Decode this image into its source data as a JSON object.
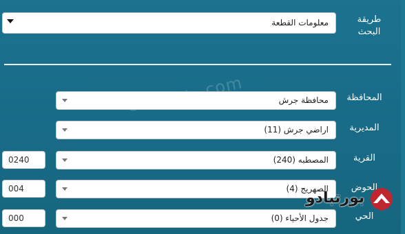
{
  "search": {
    "method_label": "طريقة البحث",
    "method_value": "معلومات القطعة"
  },
  "fields": [
    {
      "label": "المحافظة",
      "value": "محافظة جرش"
    },
    {
      "label": "المديرية",
      "value": "اراضي جرش (11)"
    },
    {
      "label": "القرية",
      "value": "المصطبه (240)",
      "code": "0240"
    },
    {
      "label": "الحوض",
      "value": "الصهريج (4)",
      "code": "004"
    },
    {
      "label": "الحي",
      "value": "جدول الأحياء (0)",
      "code": "000"
    }
  ],
  "watermark": "© www.   .com",
  "logo": {
    "text": "بورتبادو"
  }
}
